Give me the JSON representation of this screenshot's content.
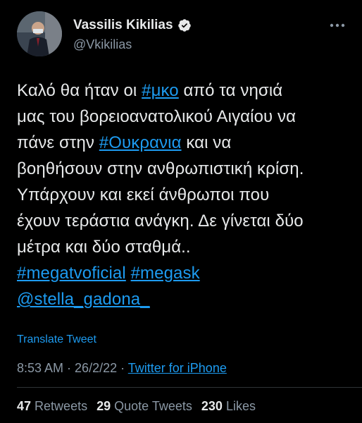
{
  "user": {
    "display_name": "Vassilis Kikilias",
    "handle": "@Vkikilias",
    "verified_icon": "verified-badge-icon",
    "avatar": "profile-photo"
  },
  "colors": {
    "background": "#000000",
    "text": "#e7e9ea",
    "secondary": "#8b98a5",
    "link": "#1d9bf0"
  },
  "tweet": {
    "lines": [
      [
        {
          "t": "Καλό θα ήταν οι "
        },
        {
          "t": "#μκο",
          "link": true
        },
        {
          "t": " από τα νησιά"
        }
      ],
      [
        {
          "t": "μας του βορειοανατολικού Αιγαίου να"
        }
      ],
      [
        {
          "t": "πάνε στην "
        },
        {
          "t": "#Ουκρανια",
          "link": true
        },
        {
          "t": " και να"
        }
      ],
      [
        {
          "t": "βοηθήσουν στην ανθρωπιστική κρίση."
        }
      ],
      [
        {
          "t": "Υπάρχουν και εκεί άνθρωποι που"
        }
      ],
      [
        {
          "t": "έχουν τεράστια ανάγκη. Δε γίνεται δύο"
        }
      ],
      [
        {
          "t": "μέτρα και δύο σταθμά.."
        }
      ],
      [
        {
          "t": "#megatvoficial",
          "link": true
        },
        {
          "t": " "
        },
        {
          "t": "#megask",
          "link": true
        }
      ],
      [
        {
          "t": "@stella_gadona_",
          "link": true
        }
      ]
    ]
  },
  "translate_label": "Translate Tweet",
  "meta": {
    "time": "8:53 AM",
    "separator": " · ",
    "date": "26/2/22",
    "source": "Twitter for iPhone"
  },
  "stats": {
    "retweets_count": "47",
    "retweets_label": "Retweets",
    "quotes_count": "29",
    "quotes_label": "Quote Tweets",
    "likes_count": "230",
    "likes_label": "Likes"
  }
}
